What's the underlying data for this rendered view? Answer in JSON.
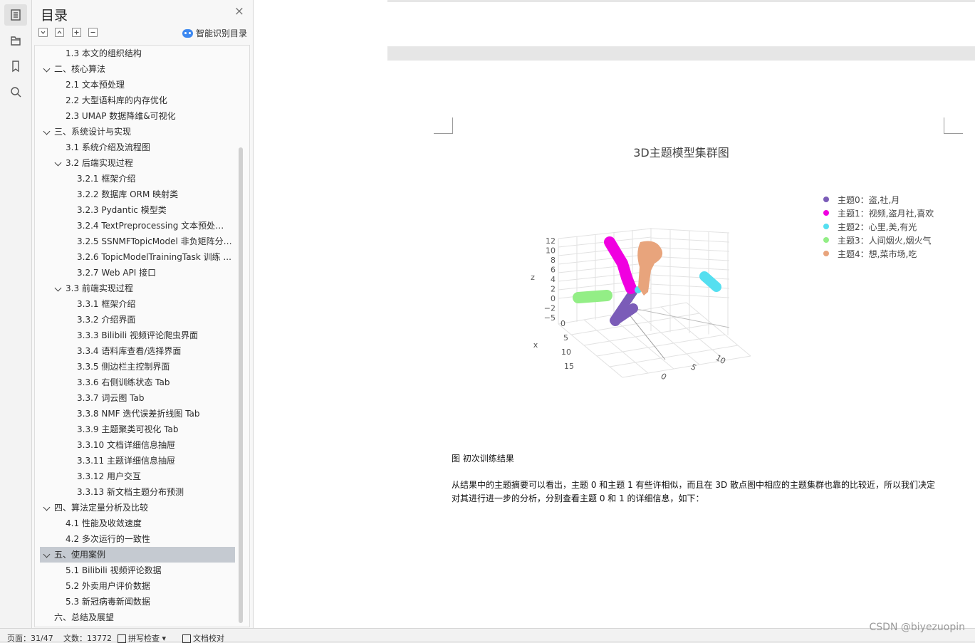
{
  "nav": {
    "title": "目录",
    "close": "×",
    "smart_label": "智能识别目录",
    "items": [
      {
        "label": "1.3 本文的组织结构",
        "level": 2
      },
      {
        "label": "二、核心算法",
        "level": 1,
        "expanded": true
      },
      {
        "label": "2.1 文本预处理",
        "level": 2
      },
      {
        "label": "2.2 大型语料库的内存优化",
        "level": 2
      },
      {
        "label": "2.3 UMAP 数据降维&可视化",
        "level": 2
      },
      {
        "label": "三、系统设计与实现",
        "level": 1,
        "expanded": true
      },
      {
        "label": "3.1 系统介绍及流程图",
        "level": 2
      },
      {
        "label": "3.2 后端实现过程",
        "level": 2,
        "expanded": true
      },
      {
        "label": "3.2.1 框架介绍",
        "level": 3
      },
      {
        "label": "3.2.2 数据库 ORM 映射类",
        "level": 3
      },
      {
        "label": "3.2.3 Pydantic 模型类",
        "level": 3
      },
      {
        "label": "3.2.4 TextPreprocessing 文本预处理 ...",
        "level": 3
      },
      {
        "label": "3.2.5 SSNMFTopicModel 非负矩阵分 ...",
        "level": 3
      },
      {
        "label": "3.2.6 TopicModelTrainingTask 训练 ...",
        "level": 3
      },
      {
        "label": "3.2.7 Web API 接口",
        "level": 3
      },
      {
        "label": "3.3 前端实现过程",
        "level": 2,
        "expanded": true
      },
      {
        "label": "3.3.1 框架介绍",
        "level": 3
      },
      {
        "label": "3.3.2 介绍界面",
        "level": 3
      },
      {
        "label": "3.3.3 Bilibili 视频评论爬虫界面",
        "level": 3
      },
      {
        "label": "3.3.4 语料库查看/选择界面",
        "level": 3
      },
      {
        "label": "3.3.5 侧边栏主控制界面",
        "level": 3
      },
      {
        "label": "3.3.6 右侧训练状态 Tab",
        "level": 3
      },
      {
        "label": "3.3.7 词云图 Tab",
        "level": 3
      },
      {
        "label": "3.3.8 NMF 迭代误差折线图 Tab",
        "level": 3
      },
      {
        "label": "3.3.9 主题聚类可视化 Tab",
        "level": 3
      },
      {
        "label": "3.3.10 文档详细信息抽屉",
        "level": 3
      },
      {
        "label": "3.3.11 主题详细信息抽屉",
        "level": 3
      },
      {
        "label": "3.3.12 用户交互",
        "level": 3
      },
      {
        "label": "3.3.13 新文档主题分布预测",
        "level": 3
      },
      {
        "label": "四、算法定量分析及比较",
        "level": 1,
        "expanded": true
      },
      {
        "label": "4.1 性能及收敛速度",
        "level": 2
      },
      {
        "label": "4.2 多次运行的一致性",
        "level": 2
      },
      {
        "label": "五、使用案例",
        "level": 1,
        "expanded": true,
        "selected": true
      },
      {
        "label": "5.1 Bilibili 视频评论数据",
        "level": 2
      },
      {
        "label": "5.2 外卖用户评价数据",
        "level": 2
      },
      {
        "label": "5.3 新冠病毒新闻数据",
        "level": 2
      },
      {
        "label": "六、总结及展望",
        "level": 1
      }
    ]
  },
  "doc": {
    "caption": "图 初次训练结果",
    "paragraph": "从结果中的主题摘要可以看出，主题 0 和主题 1 有些许相似，而且在 3D 散点图中相应的主题集群也靠的比较近，所以我们决定对其进行进一步的分析，分别查看主题 0 和 1 的详细信息，如下："
  },
  "chart_data": {
    "type": "scatter",
    "title": "3D主题模型集群图",
    "axes": {
      "z": {
        "label": "z",
        "ticks": [
          "12",
          "10",
          "8",
          "6",
          "4",
          "2",
          "0",
          "−2",
          "−5"
        ]
      },
      "x": {
        "label": "x",
        "ticks": [
          "0",
          "5",
          "10",
          "15"
        ]
      },
      "y": {
        "label": "",
        "ticks": [
          "0",
          "5",
          "10"
        ]
      }
    },
    "legend_position": "top-right",
    "series": [
      {
        "name": "主题0：盗,社,月",
        "color": "#7b5cb8"
      },
      {
        "name": "主题1：视频,盗月社,喜欢",
        "color": "#f000e0"
      },
      {
        "name": "主题2：心里,美,有光",
        "color": "#55dff0"
      },
      {
        "name": "主题3：人间烟火,烟火气",
        "color": "#93ee86"
      },
      {
        "name": "主题4：想,菜市场,吃",
        "color": "#e8a47c"
      }
    ]
  },
  "status": {
    "page": "页面：31/47",
    "words": "文数：13772",
    "spell": "拼写检查",
    "proof": "文档校对"
  },
  "watermark": "CSDN @biyezuopin"
}
